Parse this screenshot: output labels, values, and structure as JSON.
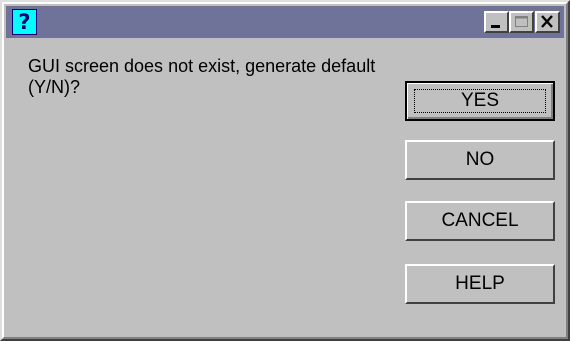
{
  "window": {
    "title_icon": "question-mark-icon",
    "title_icon_glyph": "?",
    "title_color": "#6f7399"
  },
  "titlebar_buttons": {
    "minimize_icon": "minimize-icon",
    "maximize_icon": "maximize-icon",
    "close_icon": "close-icon"
  },
  "dialog": {
    "message": "GUI screen does not exist, generate default (Y/N)?"
  },
  "buttons": {
    "yes": "YES",
    "no": "NO",
    "cancel": "CANCEL",
    "help": "HELP"
  },
  "colors": {
    "face": "#c0c0c0",
    "icon_bg": "#00ffff",
    "icon_fg": "#000080"
  }
}
